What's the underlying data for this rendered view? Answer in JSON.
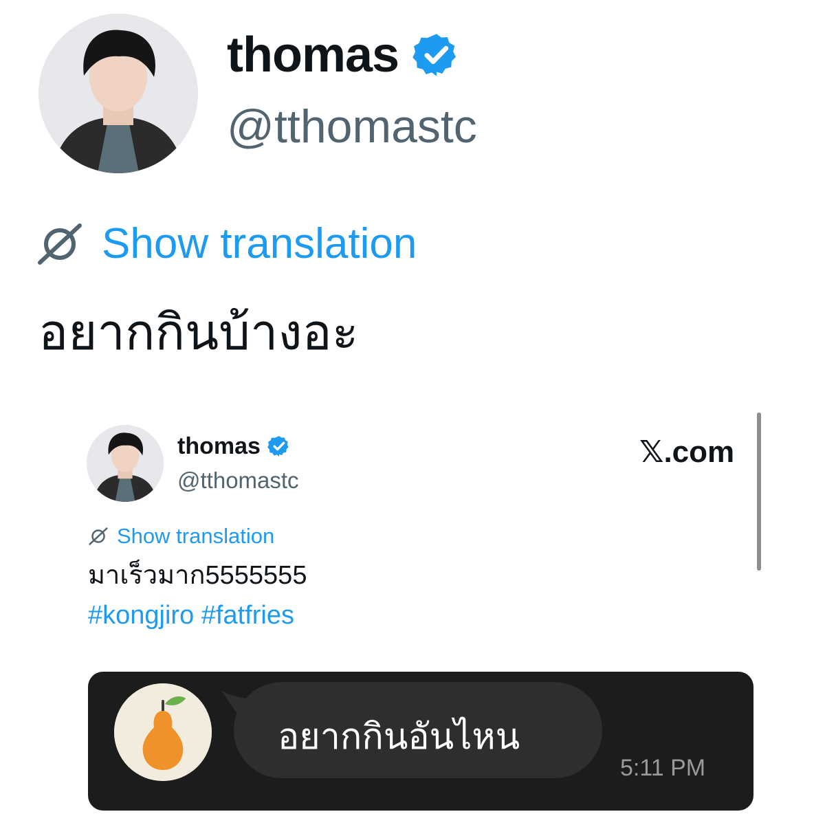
{
  "tweet": {
    "display_name": "thomas",
    "handle": "@tthomastc",
    "verified_icon": "verified-badge-icon",
    "translate_label": "Show translation",
    "translate_icon": "globe-slash-icon",
    "text": "อยากกินบ้างอะ"
  },
  "quoted_tweet": {
    "display_name": "thomas",
    "handle": "@tthomastc",
    "source": "𝕏.com",
    "translate_label": "Show translation",
    "text": "มาเร็วมาก5555555",
    "hashtags": [
      "#kongjiro",
      "#fatfries"
    ]
  },
  "chat": {
    "avatar_icon": "pear-icon",
    "message": "อยากกินอันไหน",
    "time": "5:11 PM"
  },
  "colors": {
    "link": "#1d9bf0",
    "handle": "#536471",
    "verified": "#1d9bf0",
    "chat_card": "#1c1c1c",
    "chat_bubble": "#2e2e2e",
    "pear": "#f0922b"
  }
}
